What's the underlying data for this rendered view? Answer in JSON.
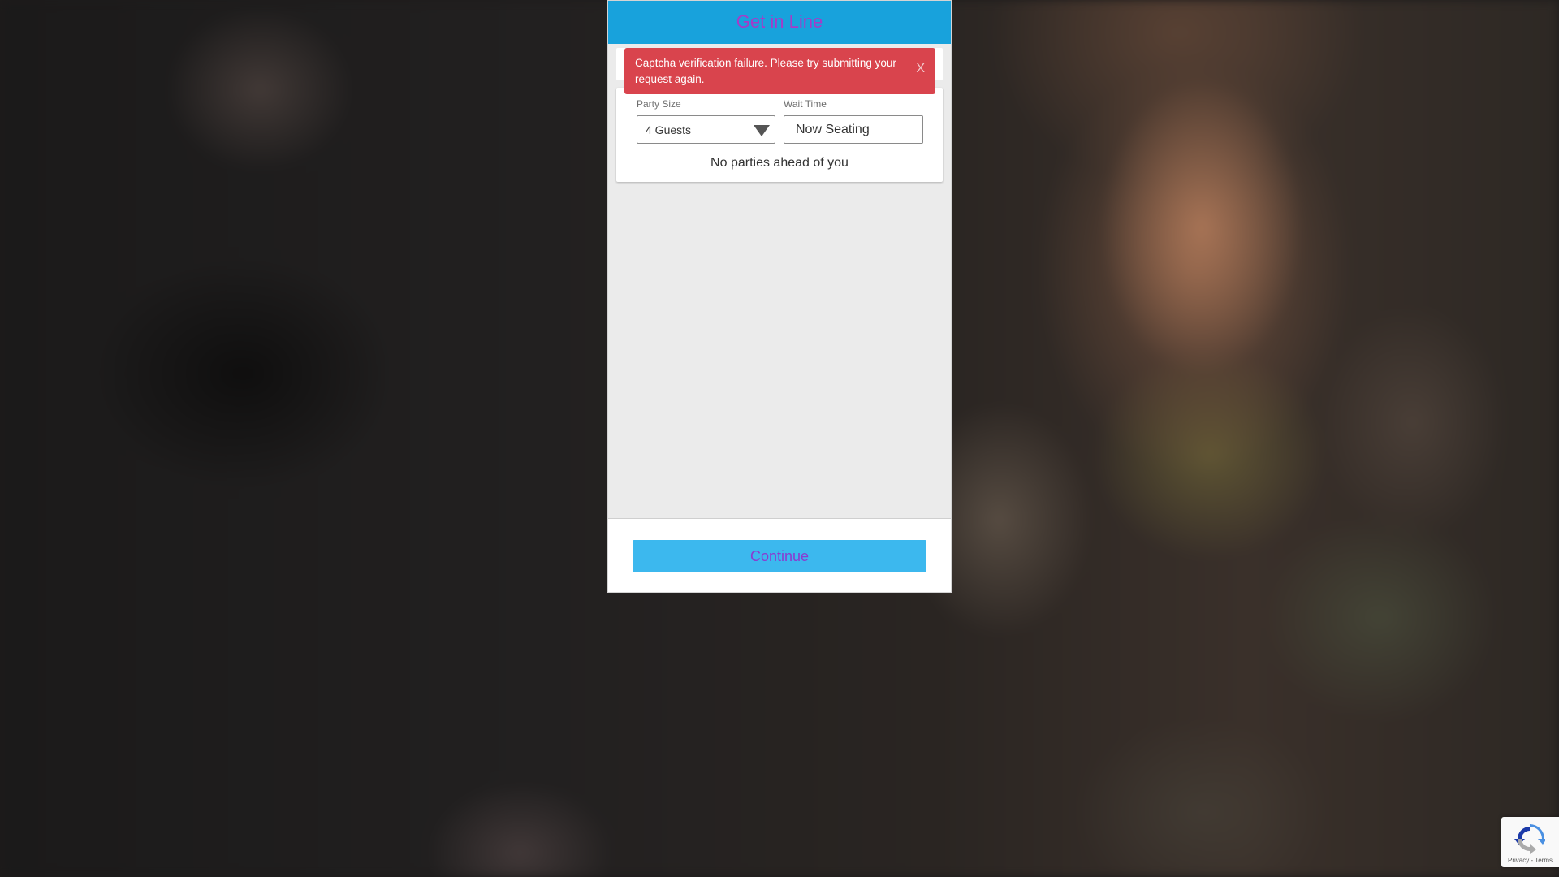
{
  "modal": {
    "title": "Get in Line",
    "alert": {
      "message": "Captcha verification failure. Please try submitting your request again.",
      "close_label": "X"
    },
    "party_size": {
      "label": "Party Size",
      "selected": "4 Guests"
    },
    "wait_time": {
      "label": "Wait Time",
      "value": "Now Seating"
    },
    "queue_status": "No parties ahead of you",
    "continue_label": "Continue"
  },
  "recaptcha": {
    "privacy": "Privacy",
    "separator": " - ",
    "terms": "Terms",
    "icon": "recaptcha-logo"
  },
  "colors": {
    "header_bg": "#18a2dc",
    "title": "#a53cc8",
    "alert_bg": "#d9444d",
    "button_bg": "#3cb8ee",
    "button_text": "#8b3ad0"
  }
}
